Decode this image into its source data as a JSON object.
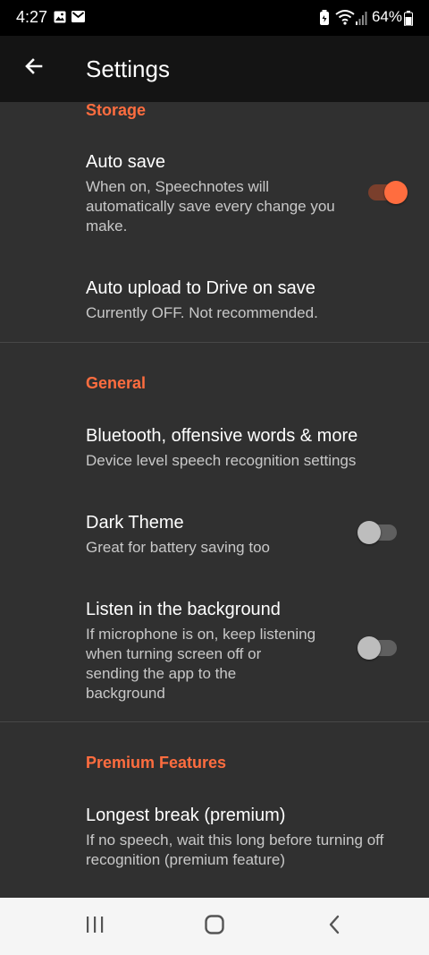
{
  "status_bar": {
    "time": "4:27",
    "battery_percent": "64%",
    "icons": [
      "gallery-icon",
      "mail-icon",
      "battery-saver-icon",
      "wifi-icon",
      "signal-icon",
      "battery-icon"
    ]
  },
  "app_bar": {
    "title": "Settings",
    "back_icon": "arrow-left-icon"
  },
  "colors": {
    "accent": "#ff6d3f",
    "background": "#303030",
    "app_bar": "#141414"
  },
  "sections": {
    "storage": {
      "header": "Storage",
      "auto_save": {
        "title": "Auto save",
        "summary": "When on, Speechnotes will automatically save every change you make.",
        "enabled": true
      },
      "auto_upload": {
        "title": "Auto upload to Drive on save",
        "summary": "Currently OFF. Not recommended."
      }
    },
    "general": {
      "header": "General",
      "bluetooth": {
        "title": "Bluetooth, offensive words & more",
        "summary": "Device level speech recognition settings"
      },
      "dark_theme": {
        "title": "Dark Theme",
        "summary": "Great for battery saving too",
        "enabled": false
      },
      "listen_background": {
        "title": "Listen in the background",
        "summary": "If microphone is on, keep listening when turning screen off or sending the app to the background",
        "enabled": false
      }
    },
    "premium": {
      "header": "Premium Features",
      "longest_break": {
        "title": "Longest break (premium)",
        "summary": "If no speech, wait this long before turning off recognition (premium feature)"
      }
    }
  },
  "nav_bar": {
    "recents_icon": "recents-icon",
    "home_icon": "home-icon",
    "back_icon": "nav-back-icon"
  }
}
